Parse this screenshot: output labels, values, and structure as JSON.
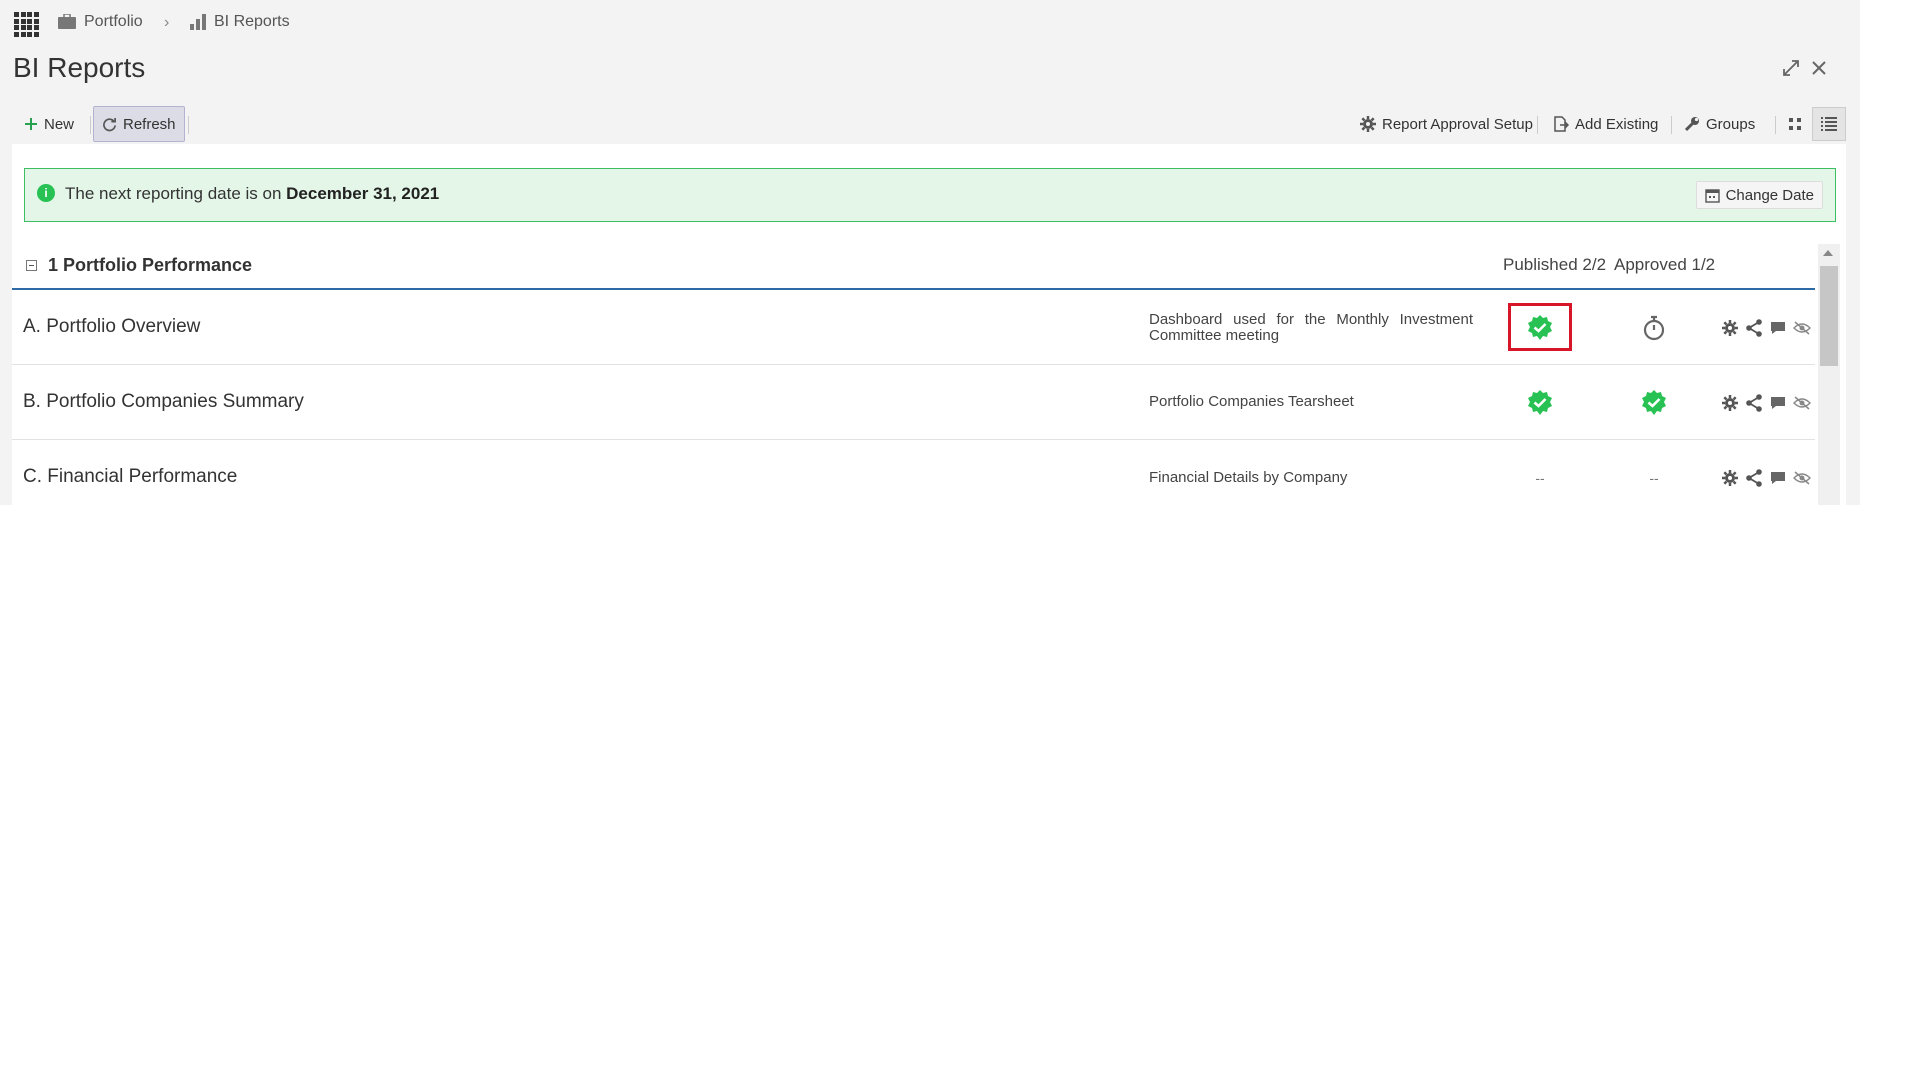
{
  "breadcrumb": {
    "items": [
      "Portfolio",
      "BI Reports"
    ],
    "separator": "›"
  },
  "page": {
    "title": "BI Reports"
  },
  "toolbar": {
    "new_label": "New",
    "refresh_label": "Refresh",
    "approval_setup_label": "Report Approval Setup",
    "add_existing_label": "Add Existing",
    "groups_label": "Groups"
  },
  "alert": {
    "text_prefix": "The next reporting date is on ",
    "date": "December 31, 2021",
    "change_date_label": "Change Date"
  },
  "group": {
    "title": "1 Portfolio Performance",
    "published_label": "Published 2/2",
    "approved_label": "Approved 1/2"
  },
  "reports": [
    {
      "name": "A. Portfolio Overview",
      "description": "Dashboard used for the Monthly Investment Committee meeting",
      "published": "check",
      "approved": "timer"
    },
    {
      "name": "B. Portfolio Companies Summary",
      "description": "Portfolio Companies Tearsheet",
      "published": "check",
      "approved": "check"
    },
    {
      "name": "C. Financial Performance",
      "description": "Financial Details by Company",
      "published": "--",
      "approved": "--"
    }
  ],
  "colors": {
    "accent_green": "#27c253",
    "alert_bg": "#e3f6e8",
    "header_rule": "#2e6aa6",
    "highlight": "#d7162a"
  }
}
